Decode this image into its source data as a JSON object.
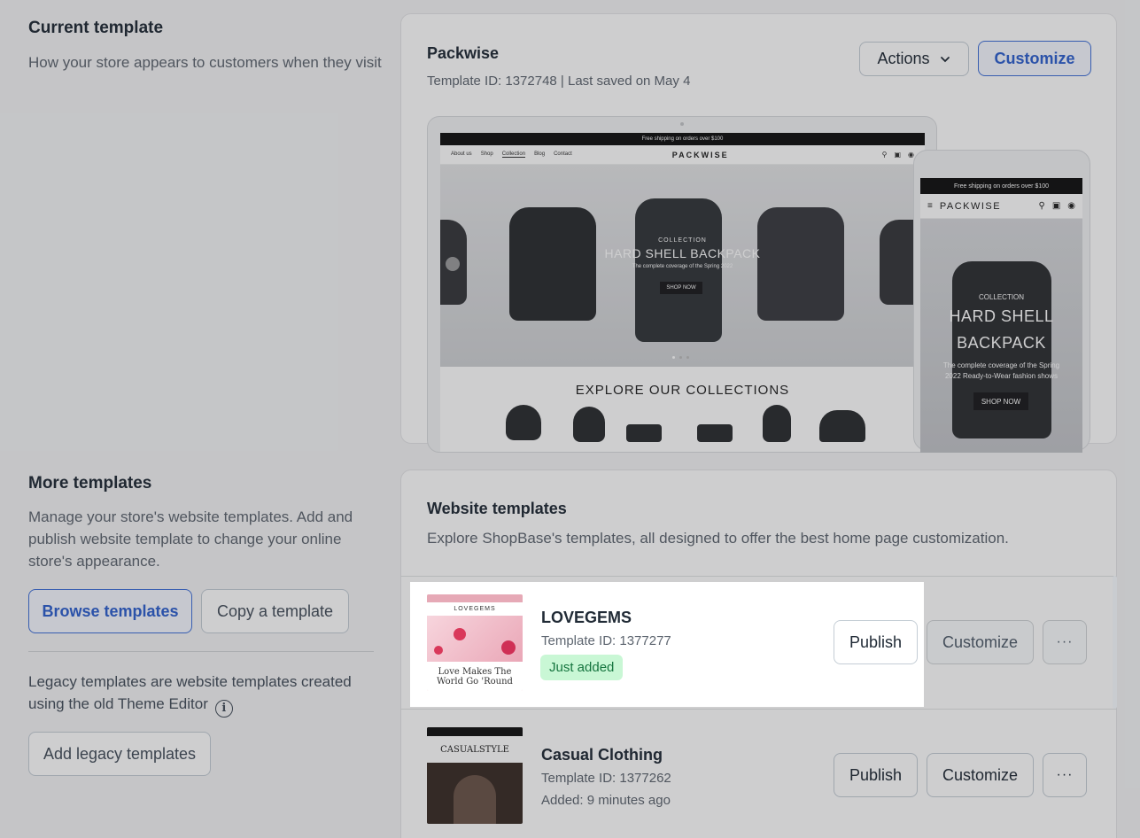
{
  "current": {
    "title": "Current template",
    "description": "How your store appears to customers when they visit",
    "template_name": "Packwise",
    "template_meta": "Template ID: 1372748 | Last saved on May 4",
    "actions_label": "Actions",
    "customize_label": "Customize"
  },
  "preview": {
    "announcement": "Free shipping on orders over $100",
    "nav_links": [
      "About us",
      "Shop",
      "Collection",
      "Blog",
      "Contact"
    ],
    "logo": "PACKWISE",
    "hero_kicker": "COLLECTION",
    "hero_title": "HARD SHELL BACKPACK",
    "hero_sub": "The complete coverage of the Spring 2022",
    "hero_cta": "SHOP NOW",
    "explore_title": "EXPLORE OUR COLLECTIONS",
    "mobile_hero_title_line1": "HARD SHELL",
    "mobile_hero_title_line2": "BACKPACK",
    "mobile_hero_sub": "The complete coverage of the Spring 2022 Ready-to-Wear fashion shows"
  },
  "more": {
    "title": "More templates",
    "description": "Manage your store's website templates. Add and publish website template to change your online store's appearance.",
    "browse_label": "Browse templates",
    "copy_label": "Copy a template",
    "legacy_text": "Legacy templates are website templates created using the old Theme Editor",
    "add_legacy_label": "Add legacy templates"
  },
  "website_templates": {
    "title": "Website templates",
    "description": "Explore ShopBase's templates, all designed to offer the best home page customization.",
    "items": [
      {
        "name": "LOVEGEMS",
        "template_id": "Template ID: 1377277",
        "status": "Just added",
        "thumb_logo": "LOVEGEMS",
        "thumb_caption": "Love Makes The World Go 'Round",
        "publish_label": "Publish",
        "customize_label": "Customize",
        "more_label": "···"
      },
      {
        "name": "Casual Clothing",
        "template_id": "Template ID: 1377262",
        "status": "Added: 9 minutes ago",
        "thumb_logo": "CASUALSTYLE",
        "publish_label": "Publish",
        "customize_label": "Customize",
        "more_label": "···"
      }
    ]
  },
  "colors": {
    "accent": "#2f60cf",
    "badge_bg": "#c9f7d5",
    "badge_text": "#16753f"
  }
}
